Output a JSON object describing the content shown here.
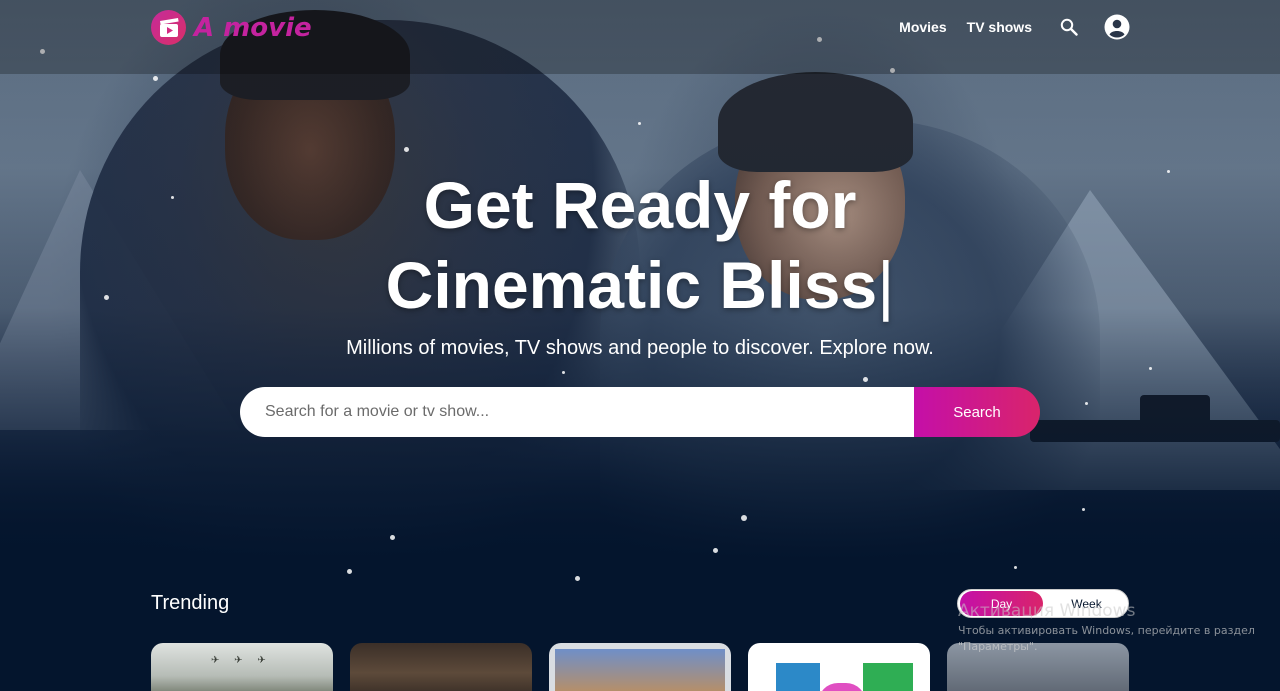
{
  "header": {
    "logo_text": "A movie",
    "logo_icon": "film-clapper-icon",
    "nav": {
      "movies": "Movies",
      "tv_shows": "TV shows"
    },
    "search_icon": "search-icon",
    "avatar_icon": "user-circle-icon"
  },
  "hero": {
    "title_line1": "Get Ready for",
    "title_line2": "Cinematic Bliss",
    "cursor": "|",
    "subtitle": "Millions of movies, TV shows and people to discover. Explore now.",
    "search": {
      "placeholder": "Search for a movie or tv show...",
      "button_label": "Search"
    }
  },
  "trending": {
    "title": "Trending",
    "switch": {
      "options": [
        "Day",
        "Week"
      ],
      "selected": "Day"
    }
  },
  "watermark": {
    "title": "Активация Windows",
    "text": "Чтобы активировать Windows, перейдите в раздел \"Параметры\"."
  },
  "colors": {
    "background": "#04152d",
    "accent_start": "#c40fa8",
    "accent_end": "#d9246b",
    "logo": "#c4239f"
  }
}
